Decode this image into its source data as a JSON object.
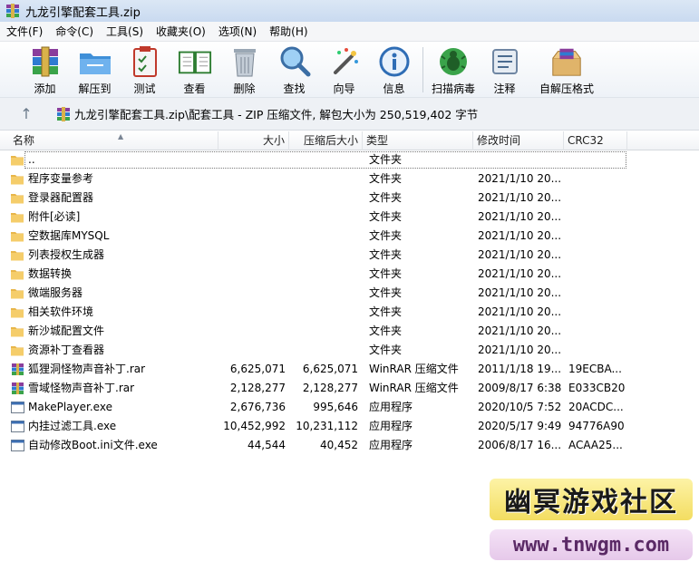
{
  "window": {
    "title": "九龙引擎配套工具.zip"
  },
  "menu": [
    "文件(F)",
    "命令(C)",
    "工具(S)",
    "收藏夹(O)",
    "选项(N)",
    "帮助(H)"
  ],
  "toolbar": [
    {
      "label": "添加",
      "icon": "add-archive-icon"
    },
    {
      "label": "解压到",
      "icon": "extract-folder-icon"
    },
    {
      "label": "测试",
      "icon": "test-clipboard-icon"
    },
    {
      "label": "查看",
      "icon": "view-book-icon"
    },
    {
      "label": "删除",
      "icon": "delete-trash-icon"
    },
    {
      "label": "查找",
      "icon": "find-magnifier-icon"
    },
    {
      "label": "向导",
      "icon": "wizard-wand-icon"
    },
    {
      "label": "信息",
      "icon": "info-icon"
    },
    {
      "label": "扫描病毒",
      "icon": "virus-scan-icon"
    },
    {
      "label": "注释",
      "icon": "comment-icon"
    },
    {
      "label": "自解压格式",
      "icon": "sfx-box-icon"
    }
  ],
  "address": {
    "path": "九龙引擎配套工具.zip\\配套工具 - ZIP 压缩文件, 解包大小为 250,519,402 字节"
  },
  "columns": {
    "name": "名称",
    "size": "大小",
    "packed": "压缩后大小",
    "type": "类型",
    "modified": "修改时间",
    "crc": "CRC32"
  },
  "files": [
    {
      "name": "..",
      "size": "",
      "packed": "",
      "type": "文件夹",
      "modified": "",
      "crc": "",
      "kind": "folder"
    },
    {
      "name": "程序变量参考",
      "size": "",
      "packed": "",
      "type": "文件夹",
      "modified": "2021/1/10 20...",
      "crc": "",
      "kind": "folder"
    },
    {
      "name": "登录器配置器",
      "size": "",
      "packed": "",
      "type": "文件夹",
      "modified": "2021/1/10 20...",
      "crc": "",
      "kind": "folder"
    },
    {
      "name": "附件[必读]",
      "size": "",
      "packed": "",
      "type": "文件夹",
      "modified": "2021/1/10 20...",
      "crc": "",
      "kind": "folder"
    },
    {
      "name": "空数据库MYSQL",
      "size": "",
      "packed": "",
      "type": "文件夹",
      "modified": "2021/1/10 20...",
      "crc": "",
      "kind": "folder"
    },
    {
      "name": "列表授权生成器",
      "size": "",
      "packed": "",
      "type": "文件夹",
      "modified": "2021/1/10 20...",
      "crc": "",
      "kind": "folder"
    },
    {
      "name": "数据转换",
      "size": "",
      "packed": "",
      "type": "文件夹",
      "modified": "2021/1/10 20...",
      "crc": "",
      "kind": "folder"
    },
    {
      "name": "微端服务器",
      "size": "",
      "packed": "",
      "type": "文件夹",
      "modified": "2021/1/10 20...",
      "crc": "",
      "kind": "folder"
    },
    {
      "name": "相关软件环境",
      "size": "",
      "packed": "",
      "type": "文件夹",
      "modified": "2021/1/10 20...",
      "crc": "",
      "kind": "folder"
    },
    {
      "name": "新沙城配置文件",
      "size": "",
      "packed": "",
      "type": "文件夹",
      "modified": "2021/1/10 20...",
      "crc": "",
      "kind": "folder"
    },
    {
      "name": "资源补丁查看器",
      "size": "",
      "packed": "",
      "type": "文件夹",
      "modified": "2021/1/10 20...",
      "crc": "",
      "kind": "folder"
    },
    {
      "name": "狐狸洞怪物声音补丁.rar",
      "size": "6,625,071",
      "packed": "6,625,071",
      "type": "WinRAR 压缩文件",
      "modified": "2011/1/18 19...",
      "crc": "19ECBA...",
      "kind": "rar"
    },
    {
      "name": "雪域怪物声音补丁.rar",
      "size": "2,128,277",
      "packed": "2,128,277",
      "type": "WinRAR 压缩文件",
      "modified": "2009/8/17 6:38",
      "crc": "E033CB20",
      "kind": "rar"
    },
    {
      "name": "MakePlayer.exe",
      "size": "2,676,736",
      "packed": "995,646",
      "type": "应用程序",
      "modified": "2020/10/5 7:52",
      "crc": "20ACDC...",
      "kind": "exe"
    },
    {
      "name": "内挂过滤工具.exe",
      "size": "10,452,992",
      "packed": "10,231,112",
      "type": "应用程序",
      "modified": "2020/5/17 9:49",
      "crc": "94776A90",
      "kind": "exe"
    },
    {
      "name": "自动修改Boot.ini文件.exe",
      "size": "44,544",
      "packed": "40,452",
      "type": "应用程序",
      "modified": "2006/8/17 16...",
      "crc": "ACAA25...",
      "kind": "exe"
    }
  ],
  "watermark": {
    "title": "幽冥游戏社区",
    "url": "www.tnwgm.com"
  }
}
